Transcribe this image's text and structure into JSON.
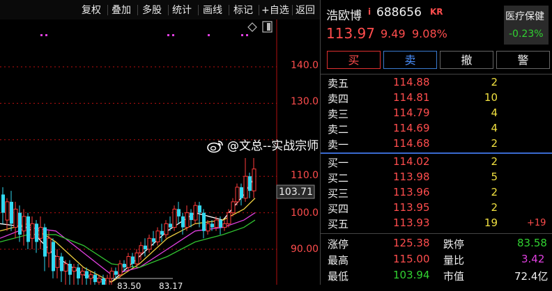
{
  "toolbar": {
    "items": [
      "复权",
      "叠加",
      "多股",
      "统计",
      "画线",
      "标记",
      "+自选",
      "返回"
    ]
  },
  "chart": {
    "price_labels": [
      "140.0",
      "130.0",
      "110.0",
      "100.0",
      "90.00"
    ],
    "current_price_tag": "103.71",
    "bottom_labels": [
      "83.50",
      "83.17"
    ],
    "colors": {
      "up": "#ff3b3b",
      "down": "#31d9f0",
      "ma5": "#ffffff",
      "ma10": "#f0d040",
      "ma20": "#e040e0",
      "ma60": "#31c431",
      "grid": "#c01010"
    }
  },
  "stock": {
    "name": "浩欧博",
    "icon_i": "i",
    "code": "688656",
    "kr": "KR",
    "price": "113.97",
    "change": "9.49",
    "change_pct": "9.08%"
  },
  "sector": {
    "name": "医疗保健",
    "change": "-0.23%"
  },
  "buttons": {
    "buy": "买",
    "sell": "卖",
    "cancel": "撤",
    "alert": "警"
  },
  "asks": [
    {
      "label": "卖五",
      "price": "114.88",
      "volume": "2"
    },
    {
      "label": "卖四",
      "price": "114.81",
      "volume": "10"
    },
    {
      "label": "卖三",
      "price": "114.79",
      "volume": "4"
    },
    {
      "label": "卖二",
      "price": "114.69",
      "volume": "4"
    },
    {
      "label": "卖一",
      "price": "114.68",
      "volume": "2"
    }
  ],
  "bids": [
    {
      "label": "买一",
      "price": "114.02",
      "volume": "2",
      "delta": ""
    },
    {
      "label": "买二",
      "price": "113.98",
      "volume": "5",
      "delta": ""
    },
    {
      "label": "买三",
      "price": "113.96",
      "volume": "2",
      "delta": ""
    },
    {
      "label": "买四",
      "price": "113.95",
      "volume": "2",
      "delta": ""
    },
    {
      "label": "买五",
      "price": "113.93",
      "volume": "19",
      "delta": "+19"
    }
  ],
  "stats": {
    "limit_up_label": "涨停",
    "limit_up": "125.38",
    "limit_down_label": "跌停",
    "limit_down": "83.58",
    "high_label": "最高",
    "high": "115.00",
    "vol_ratio_label": "量比",
    "vol_ratio": "3.42",
    "low_label": "最低",
    "low": "103.94",
    "mkt_cap_label": "市值",
    "mkt_cap": "72.4亿"
  },
  "watermark": {
    "text": "@文总--实战宗师"
  }
}
